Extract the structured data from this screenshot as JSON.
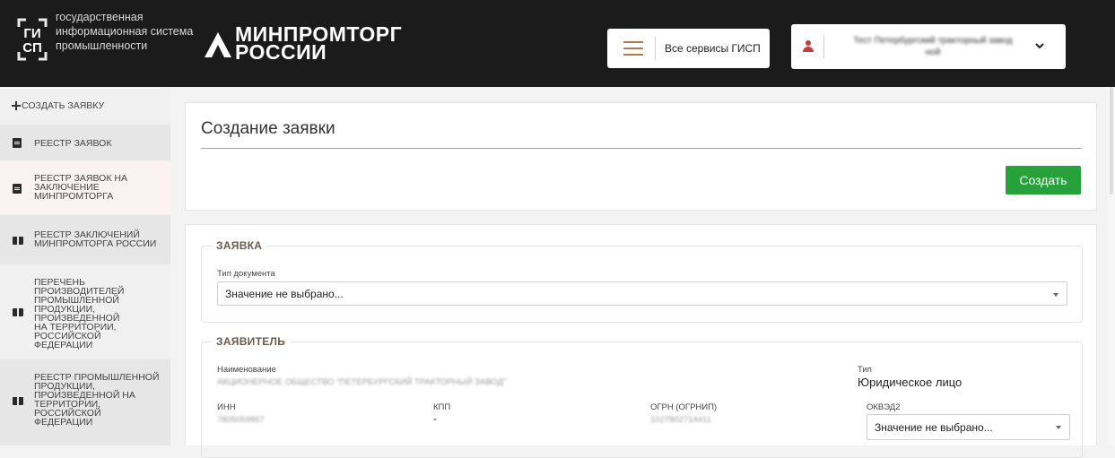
{
  "header": {
    "gisp_lines": [
      "государственная",
      "информационная система",
      "промышленности"
    ],
    "ministry_lines": [
      "МИНПРОМТОРГ",
      "РОССИИ"
    ],
    "services_label": "Все сервисы ГИСП",
    "user_name_lines": [
      "Тест Петербургский тракторный завод",
      "ной"
    ]
  },
  "sidebar": {
    "create_label": "СОЗДАТЬ ЗАЯВКУ",
    "items": [
      {
        "label": "РЕЕСТР ЗАЯВОК",
        "icon": "document-icon"
      },
      {
        "label": "РЕЕСТР ЗАЯВОК НА ЗАКЛЮЧЕНИЕ МИНПРОМТОРГА",
        "icon": "document-icon"
      },
      {
        "label": "РЕЕСТР ЗАКЛЮЧЕНИЙ МИНПРОМТОРГА РОССИИ",
        "icon": "book-icon"
      },
      {
        "label": "ПЕРЕЧЕНЬ ПРОИЗВОДИТЕЛЕЙ ПРОМЫШЛЕННОЙ ПРОДУКЦИИ, ПРОИЗВЕДЕННОЙ НА ТЕРРИТОРИИ, РОССИЙСКОЙ ФЕДЕРАЦИИ",
        "icon": "book-icon"
      },
      {
        "label": "РЕЕСТР ПРОМЫШЛЕННОЙ ПРОДУКЦИИ, ПРОИЗВЕДЕННОЙ НА ТЕРРИТОРИИ, РОССИЙСКОЙ ФЕДЕРАЦИИ",
        "icon": "book-icon"
      }
    ]
  },
  "main": {
    "title": "Создание заявки",
    "create_button": "Создать",
    "request_section": {
      "legend": "ЗАЯВКА",
      "doc_type_label": "Тип документа",
      "doc_type_value": "Значение не выбрано..."
    },
    "applicant_section": {
      "legend": "ЗАЯВИТЕЛЬ",
      "name_label": "Наименование",
      "name_value": "АКЦИОНЕРНОЕ ОБЩЕСТВО \"ПЕТЕРБУРГСКИЙ ТРАКТОРНЫЙ ЗАВОД\"",
      "type_label": "Тип",
      "type_value": "Юридическое лицо",
      "inn_label": "ИНН",
      "inn_value": "7805059867",
      "kpp_label": "КПП",
      "kpp_value": "-",
      "ogrn_label": "ОГРН (ОГРНИП)",
      "ogrn_value": "1027802714411",
      "okved_label": "ОКВЭД2",
      "okved_value": "Значение не выбрано..."
    }
  },
  "colors": {
    "header_bg": "#1b1b1b",
    "accent_brown": "#b0794f",
    "create_green": "#27a23a",
    "active_item_bg": "#fbf3f3"
  }
}
